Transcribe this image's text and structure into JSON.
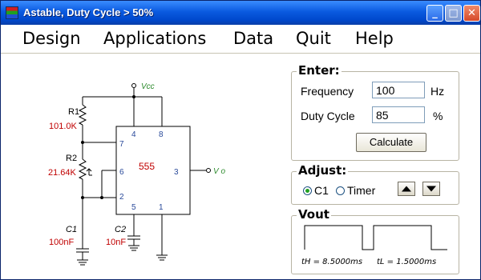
{
  "window": {
    "title": "Astable, Duty Cycle > 50%",
    "minimize_glyph": "_",
    "maximize_glyph": "□",
    "close_glyph": "✕"
  },
  "menu": [
    "Design",
    "Applications",
    "Data",
    "Quit",
    "Help"
  ],
  "circuit": {
    "vcc_label": "Vcc",
    "r1_label": "R1",
    "r1_value": "101.0K",
    "r2_label": "R2",
    "r2_value": "21.64K",
    "c1_label": "C1",
    "c1_value": "100nF",
    "c2_label": "C2",
    "c2_value": "10nF",
    "chip_label": "555",
    "pins": {
      "p4": "4",
      "p8": "8",
      "p7": "7",
      "p6": "6",
      "p3": "3",
      "p2": "2",
      "p5": "5",
      "p1": "1"
    },
    "vo_label": "V o"
  },
  "enter": {
    "title": "Enter:",
    "frequency_label": "Frequency",
    "frequency_value": "100",
    "frequency_unit": "Hz",
    "duty_label": "Duty Cycle",
    "duty_value": "85",
    "duty_unit": "%",
    "calculate_label": "Calculate"
  },
  "adjust": {
    "title": "Adjust:",
    "option_c1": "C1",
    "option_timer": "Timer",
    "selected": "C1"
  },
  "vout": {
    "title": "Vout",
    "th_text": "tH = 8.5000ms",
    "tl_text": "tL = 1.5000ms"
  },
  "colors": {
    "value_red": "#c00000",
    "label_green": "#2e8b2e",
    "chip_number": "#2a4a9a"
  }
}
